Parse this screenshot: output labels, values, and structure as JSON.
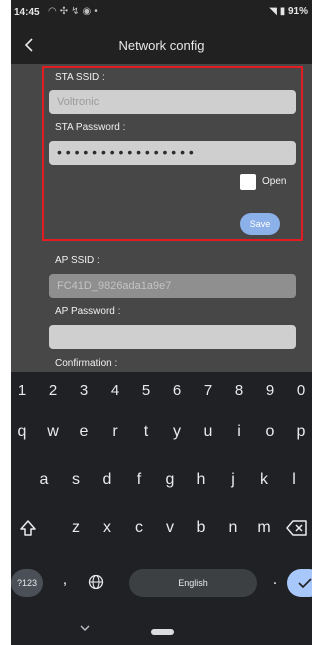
{
  "status_bar": {
    "time": "14:45",
    "battery": "91%",
    "left_icons": [
      "wifi-icon",
      "dnd-icon",
      "missed-call-icon",
      "chrome-icon",
      "dot-icon"
    ],
    "right_icons": [
      "wifi-signal-icon",
      "battery-icon"
    ]
  },
  "header": {
    "title": "Network config",
    "back_icon": "chevron-left-icon"
  },
  "form": {
    "sta_ssid_label": "STA SSID :",
    "sta_ssid_value": "Voltronic",
    "sta_password_label": "STA Password :",
    "sta_password_value": "• • • • • • • • • • • • • • • •",
    "open_label": "Open",
    "open_checked": false,
    "save_label": "Save",
    "ap_ssid_label": "AP SSID :",
    "ap_ssid_value": "FC41D_9826ada1a9e7",
    "ap_password_label": "AP Password :",
    "ap_password_value": "",
    "confirmation_label": "Confirmation :"
  },
  "keyboard": {
    "numbers": [
      "1",
      "2",
      "3",
      "4",
      "5",
      "6",
      "7",
      "8",
      "9",
      "0"
    ],
    "row1": [
      "q",
      "w",
      "e",
      "r",
      "t",
      "y",
      "u",
      "i",
      "o",
      "p"
    ],
    "row2": [
      "a",
      "s",
      "d",
      "f",
      "g",
      "h",
      "j",
      "k",
      "l"
    ],
    "row3": [
      "z",
      "x",
      "c",
      "v",
      "b",
      "n",
      "m"
    ],
    "symbols_label": "?123",
    "comma": ",",
    "period": ".",
    "space_label": "English",
    "shift_icon": "shift-icon",
    "backspace_icon": "backspace-icon",
    "globe_icon": "globe-icon",
    "enter_icon": "checkmark-icon"
  },
  "colors": {
    "accent_highlight": "#e31b23",
    "save_button": "#8cb0e8",
    "enter_key": "#a8c7fa"
  }
}
